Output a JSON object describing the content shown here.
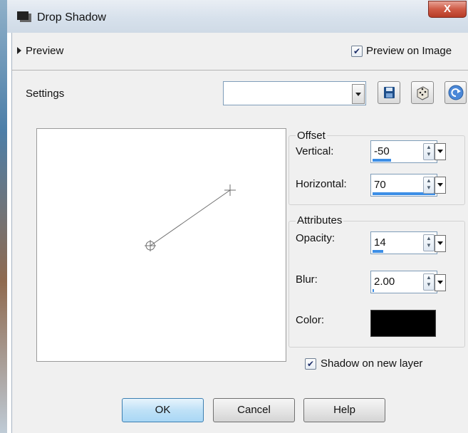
{
  "window": {
    "title": "Drop Shadow",
    "close_label": "X"
  },
  "preview": {
    "toggle_label": "Preview",
    "preview_on_image_label": "Preview on Image",
    "preview_on_image_checked": true
  },
  "settings": {
    "label": "Settings",
    "combo_value": ""
  },
  "offset": {
    "group_title": "Offset",
    "vertical_label": "Vertical:",
    "vertical_value": "-50",
    "horizontal_label": "Horizontal:",
    "horizontal_value": "70"
  },
  "attributes": {
    "group_title": "Attributes",
    "opacity_label": "Opacity:",
    "opacity_value": "14",
    "blur_label": "Blur:",
    "blur_value": "2.00",
    "color_label": "Color:",
    "color_hex": "#000000"
  },
  "shadow_new_layer": {
    "label": "Shadow on new layer",
    "checked": true
  },
  "buttons": {
    "ok": "OK",
    "cancel": "Cancel",
    "help": "Help"
  }
}
